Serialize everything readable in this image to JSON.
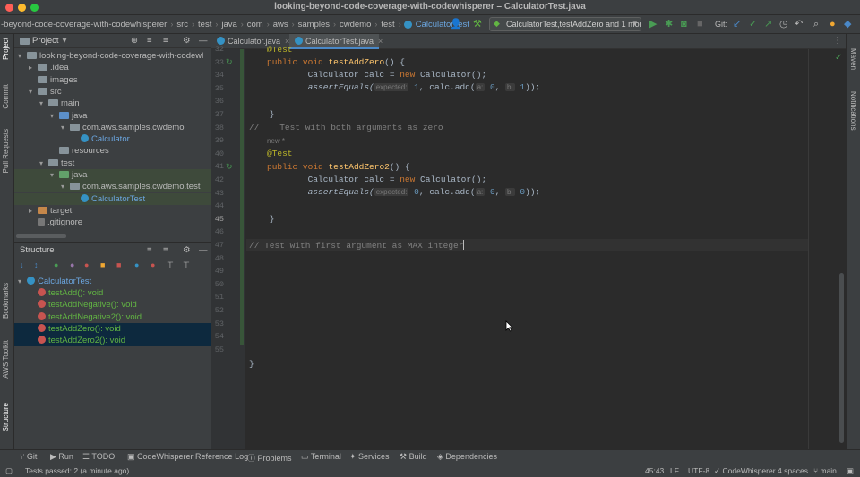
{
  "window": {
    "title": "looking-beyond-code-coverage-with-codewhisperer – CalculatorTest.java"
  },
  "navbar": {
    "crumbs": [
      "-beyond-code-coverage-with-codewhisperer",
      "src",
      "test",
      "java",
      "com",
      "aws",
      "samples",
      "cwdemo",
      "test",
      "CalculatorTest"
    ],
    "run_config": "CalculatorTest,testAddZero and 1 more",
    "git_label": "Git:"
  },
  "left_strip": [
    "Project",
    "Commit",
    "Pull Requests",
    "Bookmarks",
    "AWS Toolkit",
    "Structure"
  ],
  "right_strip": [
    "Maven",
    "Notifications"
  ],
  "project": {
    "header": "Project",
    "tree": [
      {
        "label": "looking-beyond-code-coverage-with-codewl",
        "indent": 0,
        "arrow": "open",
        "icon": "folder"
      },
      {
        "label": ".idea",
        "indent": 1,
        "arrow": "closed",
        "icon": "folder"
      },
      {
        "label": "images",
        "indent": 1,
        "arrow": "",
        "icon": "folder"
      },
      {
        "label": "src",
        "indent": 1,
        "arrow": "open",
        "icon": "folder"
      },
      {
        "label": "main",
        "indent": 2,
        "arrow": "open",
        "icon": "folder"
      },
      {
        "label": "java",
        "indent": 3,
        "arrow": "open",
        "icon": "folder-blue"
      },
      {
        "label": "com.aws.samples.cwdemo",
        "indent": 4,
        "arrow": "open",
        "icon": "folder"
      },
      {
        "label": "Calculator",
        "indent": 5,
        "arrow": "",
        "icon": "class"
      },
      {
        "label": "resources",
        "indent": 3,
        "arrow": "",
        "icon": "folder"
      },
      {
        "label": "test",
        "indent": 2,
        "arrow": "open",
        "icon": "folder"
      },
      {
        "label": "java",
        "indent": 3,
        "arrow": "open",
        "icon": "folder-green"
      },
      {
        "label": "com.aws.samples.cwdemo.test",
        "indent": 4,
        "arrow": "open",
        "icon": "folder"
      },
      {
        "label": "CalculatorTest",
        "indent": 5,
        "arrow": "",
        "icon": "class"
      },
      {
        "label": "target",
        "indent": 1,
        "arrow": "closed",
        "icon": "folder-orange"
      },
      {
        "label": ".gitignore",
        "indent": 1,
        "arrow": "",
        "icon": "file"
      }
    ]
  },
  "structure": {
    "header": "Structure",
    "root": "CalculatorTest",
    "methods": [
      "testAdd(): void",
      "testAddNegative(): void",
      "testAddNegative2(): void",
      "testAddZero(): void",
      "testAddZero2(): void"
    ]
  },
  "tabs": [
    {
      "label": "Calculator.java",
      "active": false
    },
    {
      "label": "CalculatorTest.java",
      "active": true
    }
  ],
  "editor": {
    "line_numbers": [
      "32",
      "33",
      "34",
      "35",
      "36",
      "37",
      "38",
      "39",
      "40",
      "41",
      "42",
      "43",
      "44",
      "45",
      "46",
      "47",
      "48",
      "49",
      "50",
      "51",
      "52",
      "53",
      "54",
      "55"
    ],
    "l32": {
      "ann": "@Test"
    },
    "l33": {
      "kw1": "public",
      "kw2": "void",
      "fn": "testAddZero",
      "rest": "() {"
    },
    "l34": {
      "text": "        Calculator calc = ",
      "kw": "new",
      "rest": " Calculator();"
    },
    "l35": {
      "fn": "assertEquals(",
      "h1": "expected:",
      "v1": "1",
      "mid": ", calc.add(",
      "h2": "a:",
      "v2": "0",
      "c": ", ",
      "h3": "b:",
      "v3": "1",
      "end": "));"
    },
    "l37": {
      "text": "    }"
    },
    "l38": {
      "text": "//    Test with both arguments as zero"
    },
    "vc": "new *",
    "l39": {
      "ann": "@Test"
    },
    "l40": {
      "kw1": "public",
      "kw2": "void",
      "fn": "testAddZero2",
      "rest": "() {"
    },
    "l41": {
      "text": "        Calculator calc = ",
      "kw": "new",
      "rest": " Calculator();"
    },
    "l42": {
      "fn": "assertEquals(",
      "h1": "expected:",
      "v1": "0",
      "mid": ", calc.add(",
      "h2": "a:",
      "v2": "0",
      "c": ", ",
      "h3": "b:",
      "v3": "0",
      "end": "));"
    },
    "l44": {
      "text": "    }"
    },
    "l46": {
      "text": "// Test with first argument as MAX integer"
    },
    "l55": {
      "text": "}"
    }
  },
  "bottom_tools": [
    "Git",
    "Run",
    "TODO",
    "CodeWhisperer Reference Log",
    "Problems",
    "Terminal",
    "Services",
    "Build",
    "Dependencies"
  ],
  "status": {
    "message": "Tests passed: 2 (a minute ago)",
    "position": "45:43",
    "line_sep": "LF",
    "encoding": "UTF-8",
    "codewhisperer": "CodeWhisperer",
    "indent": "4 spaces",
    "branch": "main"
  },
  "colors": {
    "accent": "#4a88c7",
    "success": "#499c54",
    "selection": "#0d293e"
  }
}
